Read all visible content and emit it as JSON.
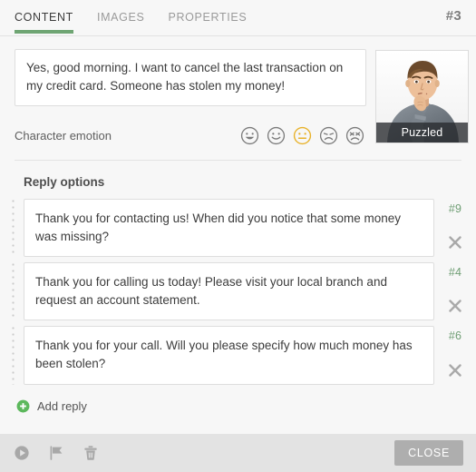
{
  "header": {
    "tabs": [
      {
        "label": "CONTENT",
        "active": true
      },
      {
        "label": "IMAGES",
        "active": false
      },
      {
        "label": "PROPERTIES",
        "active": false
      }
    ],
    "node_number": "#3",
    "active_tab_underline_color": "#6fa573"
  },
  "utterance": {
    "text": "Yes, good morning. I want to cancel the last transaction on my credit card. Someone has stolen my money!"
  },
  "emotion": {
    "label": "Character emotion",
    "selected_index": 2,
    "selected_color": "#e8b22a",
    "unselected_color": "#7a7a7a",
    "options": [
      {
        "name": "grinning-face",
        "title": "Happy"
      },
      {
        "name": "smiling-face",
        "title": "Content"
      },
      {
        "name": "neutral-face",
        "title": "Neutral"
      },
      {
        "name": "frowning-face",
        "title": "Sad"
      },
      {
        "name": "angry-face",
        "title": "Angry"
      }
    ]
  },
  "character": {
    "caption": "Puzzled"
  },
  "replies": {
    "title": "Reply options",
    "items": [
      {
        "text": "Thank you for contacting us! When did you notice that some money was missing?",
        "number": "#9"
      },
      {
        "text": "Thank you for calling us today! Please visit your local branch and request an account statement.",
        "number": "#4"
      },
      {
        "text": "Thank you for your call. Will you please specify how much money has been stolen?",
        "number": "#6"
      }
    ],
    "add_label": "Add reply",
    "add_icon_color": "#5cb85c",
    "number_color": "#6f9e74"
  },
  "footer": {
    "tools": [
      {
        "name": "play-icon"
      },
      {
        "name": "flag-icon"
      },
      {
        "name": "trash-icon"
      }
    ],
    "close_label": "CLOSE"
  }
}
